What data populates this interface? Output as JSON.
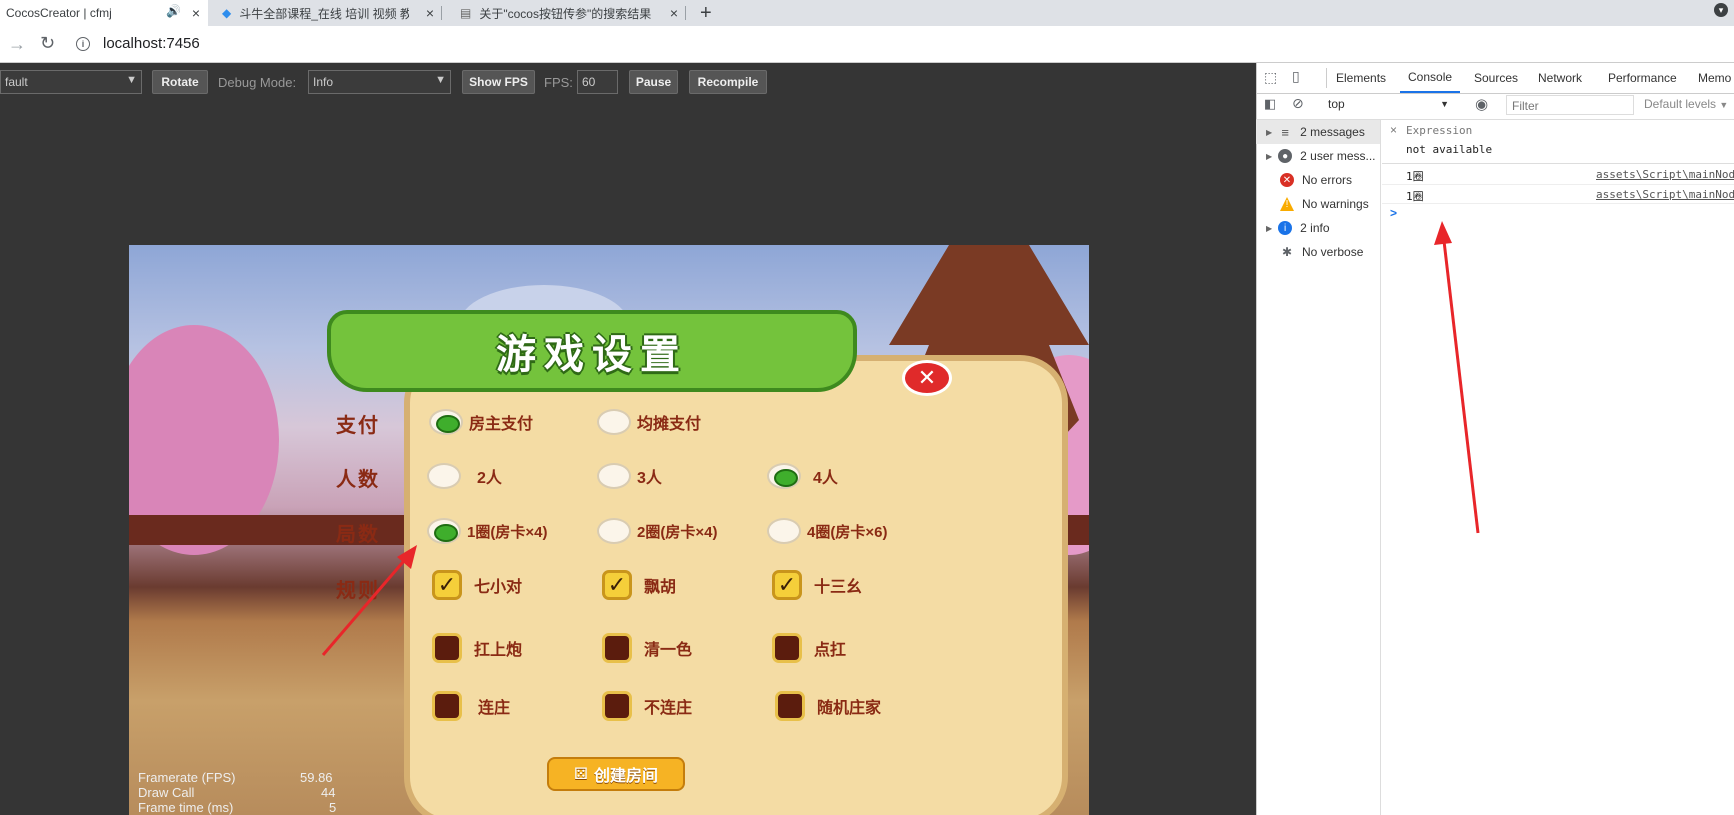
{
  "browser": {
    "tabs": [
      {
        "title": "CocosCreator | cfmj",
        "active": true
      },
      {
        "title": "斗牛全部课程_在线 培训 视频 教"
      },
      {
        "title": "关于\"cocos按钮传参\"的搜索结果"
      }
    ],
    "url": "localhost:7456"
  },
  "cocos_toolbar": {
    "device_select": "fault",
    "rotate_label": "Rotate",
    "debug_mode_label": "Debug Mode:",
    "debug_mode_value": "Info",
    "show_fps_label": "Show FPS",
    "fps_label": "FPS:",
    "fps_value": "60",
    "pause_label": "Pause",
    "recompile_label": "Recompile"
  },
  "game": {
    "title": "游戏设置",
    "rows": {
      "pay": {
        "label": "支付",
        "options": [
          {
            "text": "房主支付",
            "selected": true
          },
          {
            "text": "均摊支付",
            "selected": false
          }
        ]
      },
      "players": {
        "label": "人数",
        "options": [
          {
            "text": "2人",
            "selected": false
          },
          {
            "text": "3人",
            "selected": false
          },
          {
            "text": "4人",
            "selected": true
          }
        ]
      },
      "rounds": {
        "label": "局数",
        "options": [
          {
            "text": "1圈(房卡×4)",
            "selected": true
          },
          {
            "text": "2圈(房卡×4)",
            "selected": false
          },
          {
            "text": "4圈(房卡×6)",
            "selected": false
          }
        ]
      },
      "rules": {
        "label": "规则",
        "options": [
          {
            "text": "七小对",
            "checked": true
          },
          {
            "text": "飘胡",
            "checked": true
          },
          {
            "text": "十三幺",
            "checked": true
          },
          {
            "text": "扛上炮",
            "checked": false
          },
          {
            "text": "清一色",
            "checked": false
          },
          {
            "text": "点扛",
            "checked": false
          },
          {
            "text": "连庄",
            "checked": false
          },
          {
            "text": "不连庄",
            "checked": false
          },
          {
            "text": "随机庄家",
            "checked": false
          }
        ]
      }
    },
    "create_room_label": "创建房间",
    "stats": {
      "fps_label": "Framerate (FPS)",
      "fps_value": "59.86",
      "draw_call_label": "Draw Call",
      "draw_call_value": "44",
      "frame_time_label": "Frame time (ms)",
      "frame_time_value": "5"
    }
  },
  "devtools": {
    "tabs": [
      "Elements",
      "Console",
      "Sources",
      "Network",
      "Performance",
      "Memo"
    ],
    "active_tab": "Console",
    "context": "top",
    "filter_placeholder": "Filter",
    "levels": "Default levels",
    "sidebar": [
      "2 messages",
      "2 user mess...",
      "No errors",
      "No warnings",
      "2 info",
      "No verbose"
    ],
    "expression_label": "Expression",
    "expression_value": "not available",
    "logs": [
      {
        "text": "1圈",
        "source": "assets\\Script\\mainNod"
      },
      {
        "text": "1圈",
        "source": "assets\\Script\\mainNod"
      }
    ],
    "prompt": ">"
  },
  "colors": {
    "accent": "#1a73e8",
    "error": "#d93025",
    "warning": "#f9ab00",
    "info": "#1a73e8",
    "annotation": "#e8262a"
  }
}
